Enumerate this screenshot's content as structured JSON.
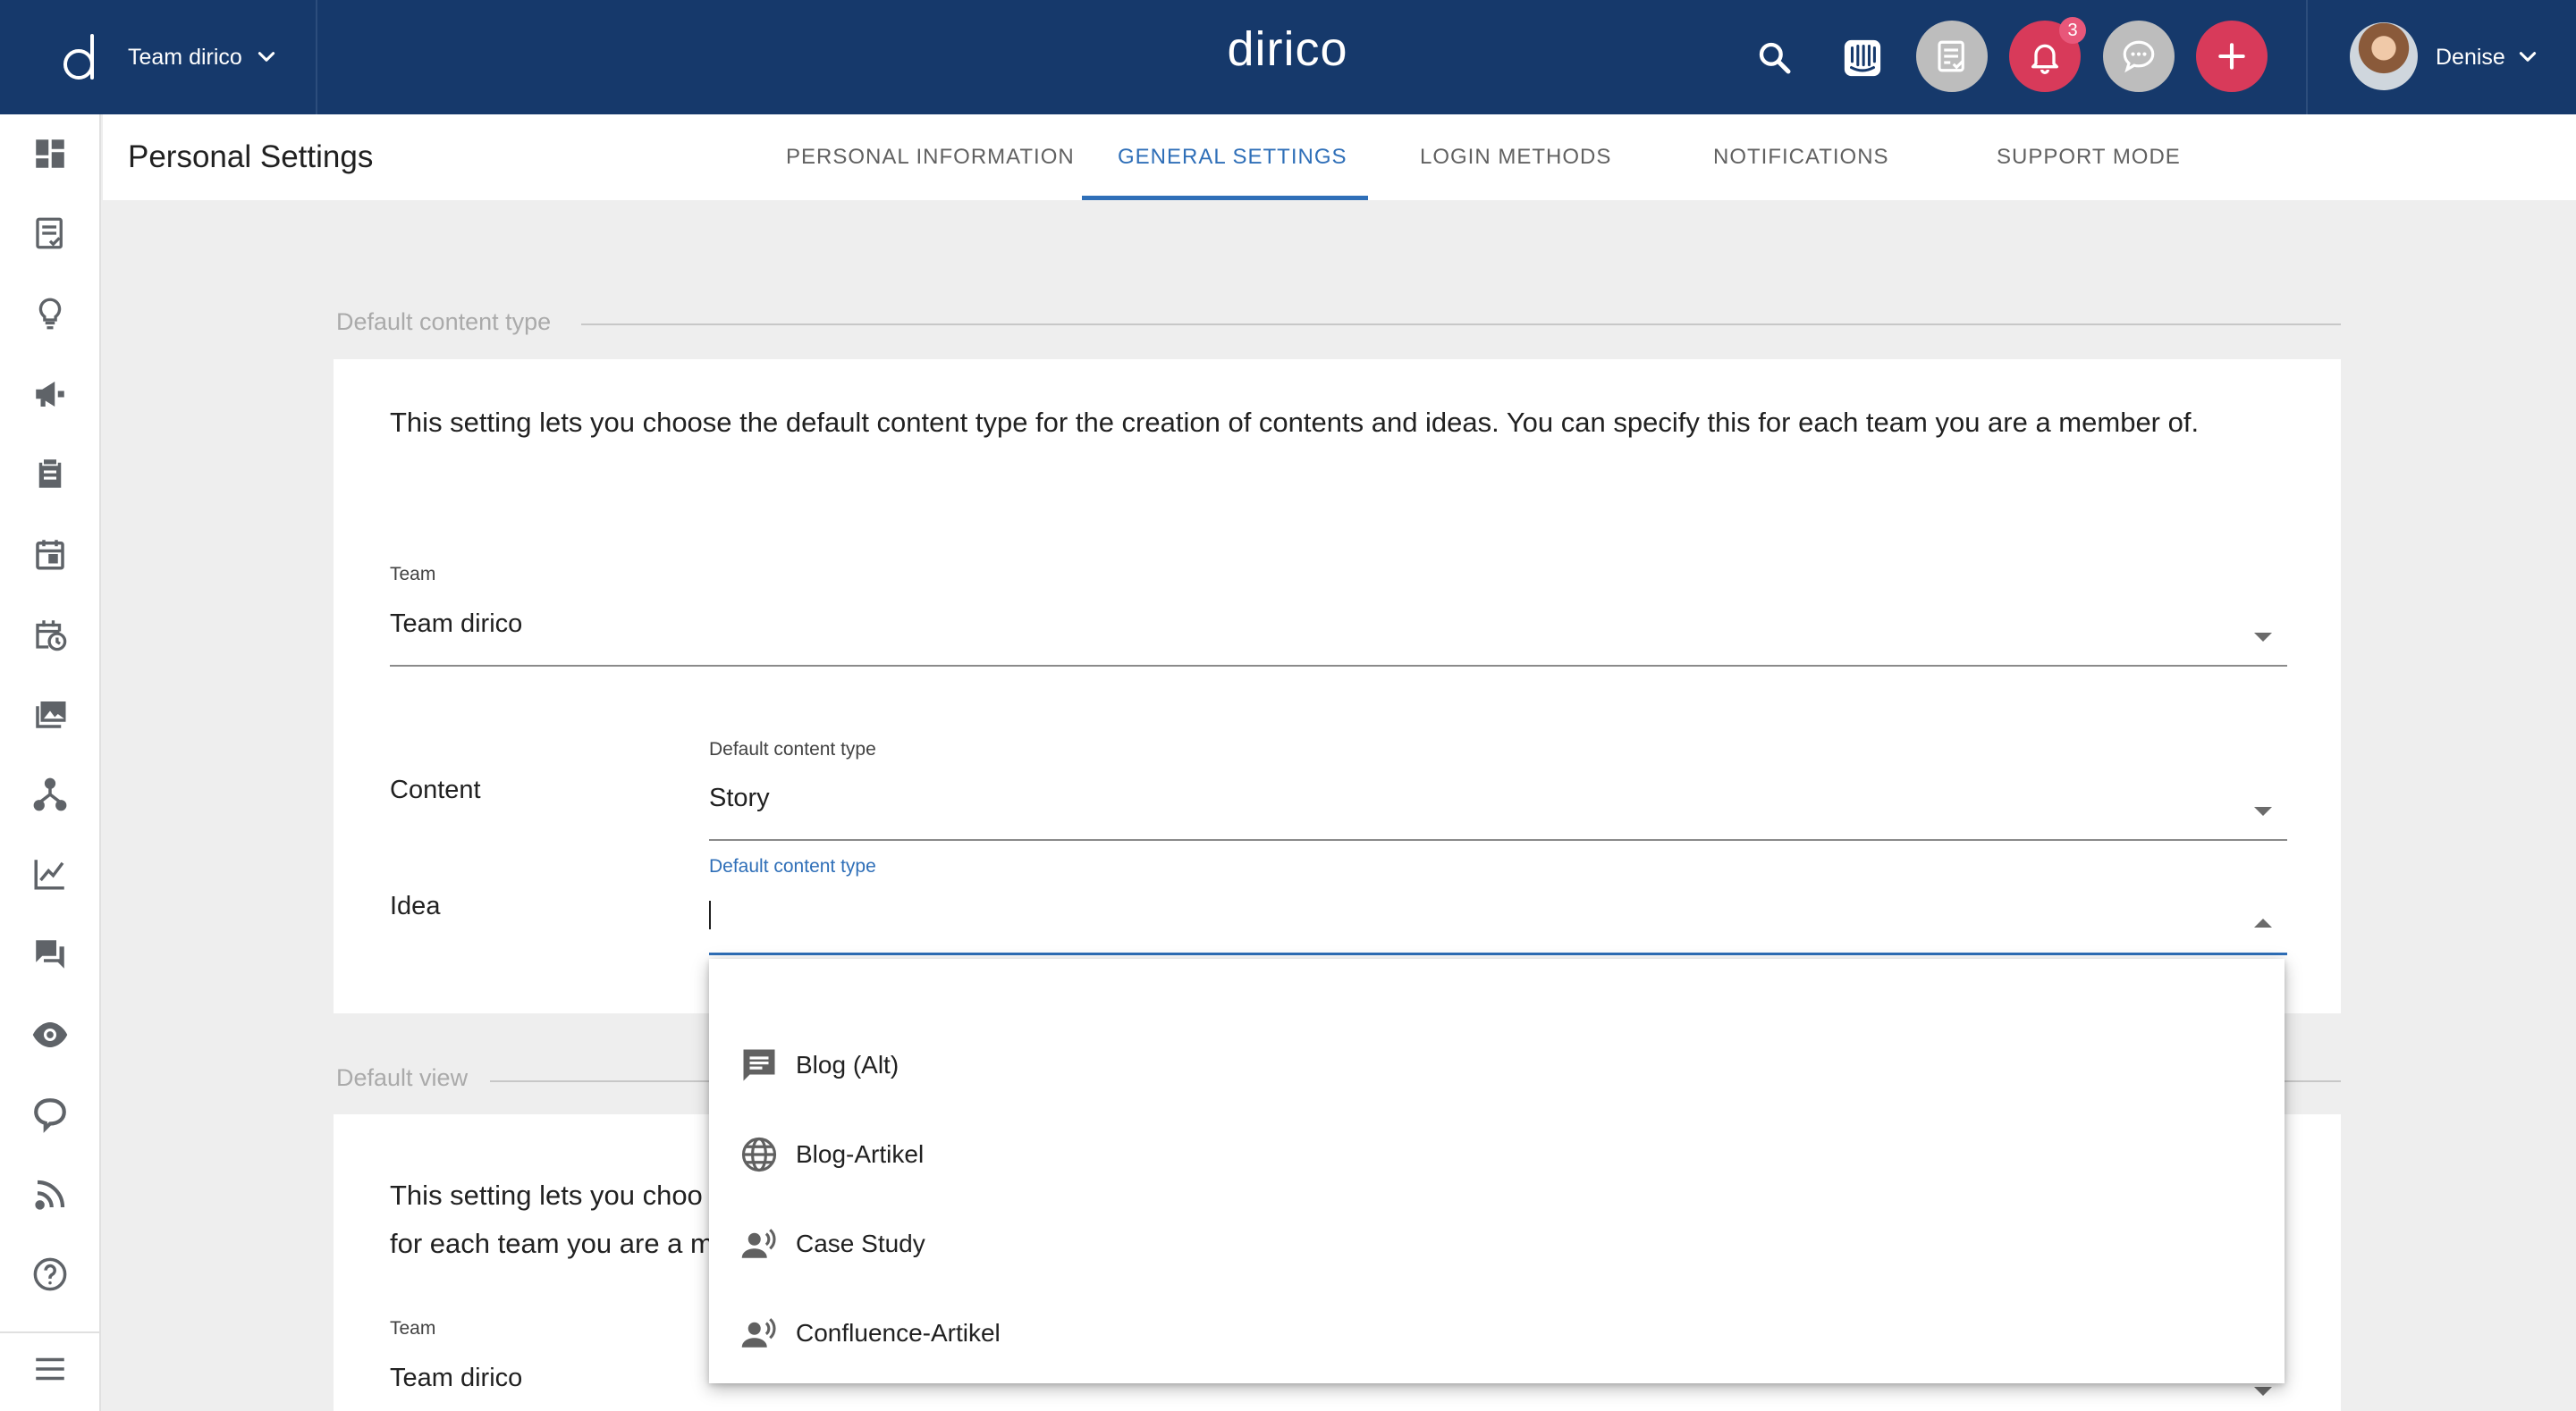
{
  "topbar": {
    "team_label": "Team dirico",
    "brand": "dirico",
    "notification_count": "3",
    "user_name": "Denise"
  },
  "header": {
    "title": "Personal Settings",
    "tabs": [
      {
        "label": "PERSONAL INFORMATION",
        "active": false
      },
      {
        "label": "GENERAL SETTINGS",
        "active": true
      },
      {
        "label": "LOGIN METHODS",
        "active": false
      },
      {
        "label": "NOTIFICATIONS",
        "active": false
      },
      {
        "label": "SUPPORT MODE",
        "active": false
      }
    ]
  },
  "default_content_type": {
    "legend": "Default content type",
    "description": "This setting lets you choose the default content type for the creation of contents and ideas. You can specify this for each team you are a member of.",
    "team_field": {
      "label": "Team",
      "value": "Team dirico"
    },
    "content_row": {
      "label": "Content",
      "field_label": "Default content type",
      "value": "Story"
    },
    "idea_row": {
      "label": "Idea",
      "field_label": "Default content type",
      "value": ""
    }
  },
  "default_view": {
    "legend": "Default view",
    "description_line1": "This setting lets you choo",
    "description_line2": "for each team you are a m",
    "team_field": {
      "label": "Team",
      "value": "Team dirico"
    }
  },
  "dropdown": {
    "options": [
      {
        "label": "Blog (Alt)",
        "icon": "chat-bubble-icon"
      },
      {
        "label": "Blog-Artikel",
        "icon": "globe-icon"
      },
      {
        "label": "Case Study",
        "icon": "speaking-person-icon"
      },
      {
        "label": "Confluence-Artikel",
        "icon": "speaking-person-icon"
      }
    ]
  },
  "colors": {
    "topbar": "#16396b",
    "accent": "#2f6fb8",
    "notification": "#d83a5a"
  }
}
